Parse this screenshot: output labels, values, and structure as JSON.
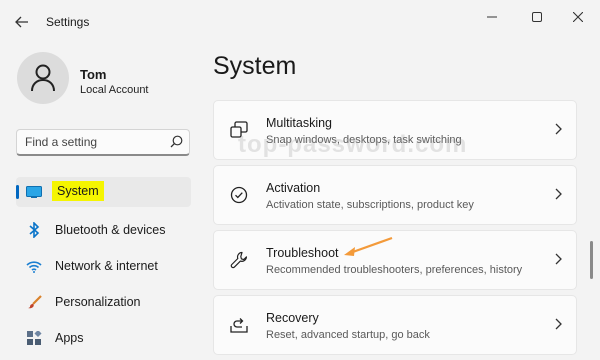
{
  "window": {
    "title": "Settings",
    "controls": [
      "minimize-icon",
      "maximize-icon",
      "close-icon"
    ]
  },
  "profile": {
    "name": "Tom",
    "account_type": "Local Account"
  },
  "search": {
    "placeholder": "Find a setting"
  },
  "sidebar": {
    "items": [
      {
        "label": "System",
        "icon": "system-display-icon",
        "selected": true
      },
      {
        "label": "Bluetooth & devices",
        "icon": "bluetooth-icon"
      },
      {
        "label": "Network & internet",
        "icon": "wifi-icon"
      },
      {
        "label": "Personalization",
        "icon": "brush-icon"
      },
      {
        "label": "Apps",
        "icon": "apps-icon"
      }
    ]
  },
  "main": {
    "title": "System",
    "watermark": "top-password.com",
    "cards": [
      {
        "title": "Multitasking",
        "desc": "Snap windows, desktops, task switching",
        "icon": "multitasking-icon"
      },
      {
        "title": "Activation",
        "desc": "Activation state, subscriptions, product key",
        "icon": "activation-check-icon"
      },
      {
        "title": "Troubleshoot",
        "desc": "Recommended troubleshooters, preferences, history",
        "icon": "wrench-icon"
      },
      {
        "title": "Recovery",
        "desc": "Reset, advanced startup, go back",
        "icon": "recovery-icon"
      }
    ]
  },
  "colors": {
    "accent": "#0067c0",
    "highlight": "#f5f500",
    "annotation_arrow": "#f39a3a"
  }
}
